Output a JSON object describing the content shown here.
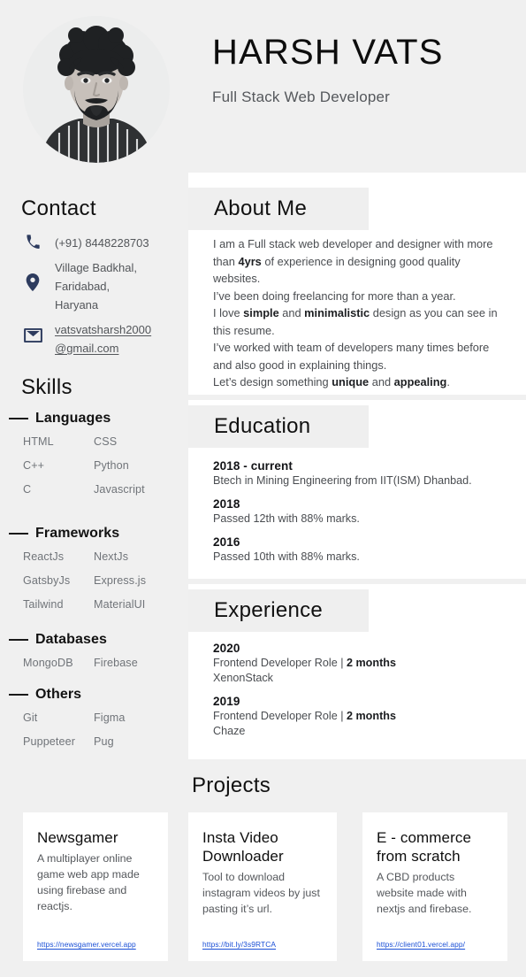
{
  "header": {
    "name": "HARSH VATS",
    "title": "Full Stack Web Developer",
    "photo_alt": "profile-photo"
  },
  "sidebar": {
    "contact_heading": "Contact",
    "contact": {
      "phone_icon": "phone-icon",
      "phone": "(+91) 8448228703",
      "location_icon": "location-pin-icon",
      "address_line1": "Village Badkhal,",
      "address_line2": "Faridabad,",
      "address_line3": "Haryana",
      "email_icon": "envelope-icon",
      "email_line1": "vatsvatsharsh2000",
      "email_line2": "@gmail.com"
    },
    "skills_heading": "Skills",
    "skill_groups": [
      {
        "title": "Languages",
        "items": [
          "HTML",
          "CSS",
          "C++",
          "Python",
          "C",
          "Javascript"
        ]
      },
      {
        "title": "Frameworks",
        "items": [
          "ReactJs",
          "NextJs",
          "GatsbyJs",
          "Express.js",
          "Tailwind",
          "MaterialUI"
        ]
      },
      {
        "title": "Databases",
        "items": [
          "MongoDB",
          "Firebase"
        ]
      },
      {
        "title": "Others",
        "items": [
          "Git",
          "Figma",
          "Puppeteer",
          "Pug"
        ]
      }
    ]
  },
  "about": {
    "heading": "About Me",
    "lines": [
      "I am a Full stack web developer and designer with more than <b>4yrs</b> of experience in designing good quality websites.",
      "I’ve been doing freelancing for more than a year.",
      "I love <b>simple</b> and <b>minimalistic</b> design as you can see in this resume.",
      "I’ve worked with team of developers many times before and also good in explaining things.",
      "Let’s design something <b>unique</b> and <b>appealing</b>."
    ]
  },
  "education": {
    "heading": "Education",
    "entries": [
      {
        "year": "2018 - current",
        "desc": "Btech in Mining Engineering from IIT(ISM) Dhanbad."
      },
      {
        "year": "2018",
        "desc": "Passed 12th with 88% marks."
      },
      {
        "year": "2016",
        "desc": "Passed 10th with 88% marks."
      }
    ]
  },
  "experience": {
    "heading": "Experience",
    "entries": [
      {
        "year": "2020",
        "desc": "Frontend Developer Role | <b>2 months</b>",
        "company": "XenonStack"
      },
      {
        "year": "2019",
        "desc": "Frontend Developer Role | <b>2 months</b>",
        "company": "Chaze"
      }
    ]
  },
  "projects": {
    "heading": "Projects",
    "cards": [
      {
        "title": "Newsgamer",
        "desc": "A multiplayer online game web app made using firebase and reactjs.",
        "link": "https://newsgamer.vercel.app"
      },
      {
        "title": "Insta Video Downloader",
        "desc": "Tool to download instagram videos by just pasting it’s url.",
        "link": "https://bit.ly/3s9RTCA"
      },
      {
        "title": "E - commerce from scratch",
        "desc": "A CBD products website made with nextjs and firebase.",
        "link": "https://client01.vercel.app/"
      }
    ]
  },
  "colors": {
    "page_bg": "#f0f0f0",
    "panel_bg": "#ffffff",
    "band_bg": "#efefef",
    "icon_navy": "#2d3b5e",
    "link_blue": "#1a4fd6",
    "heading_dark": "#101010",
    "body_gray": "#4a4d51",
    "skill_gray": "#707479"
  }
}
